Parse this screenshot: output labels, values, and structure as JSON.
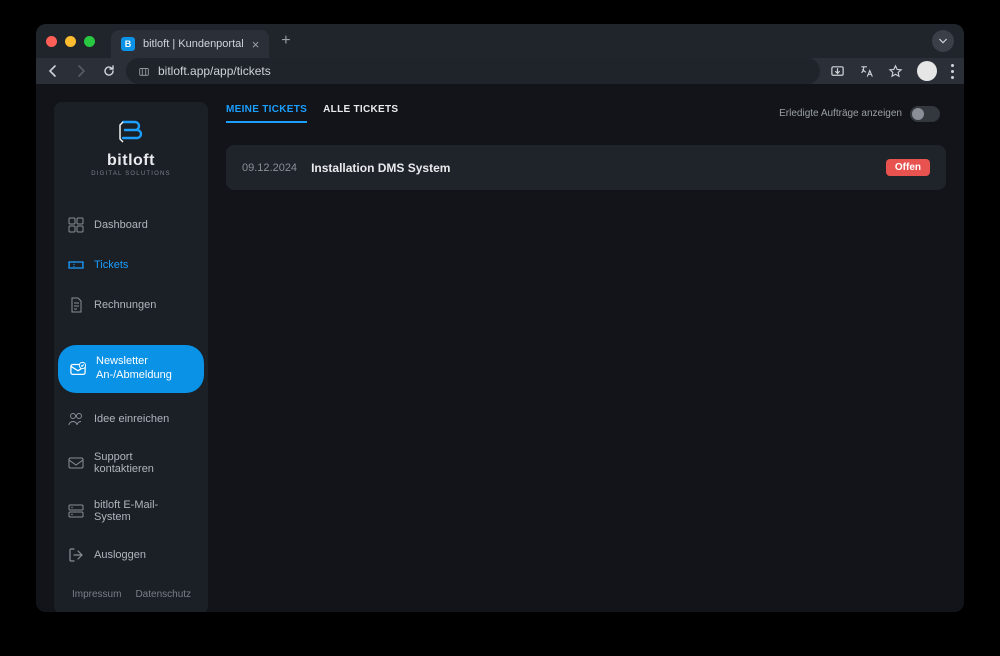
{
  "browser": {
    "tab_title": "bitloft | Kundenportal",
    "url": "bitloft.app/app/tickets"
  },
  "logo": {
    "name": "bitloft",
    "subtitle": "Digital Solutions"
  },
  "sidebar": {
    "items": [
      {
        "label": "Dashboard"
      },
      {
        "label": "Tickets"
      },
      {
        "label": "Rechnungen"
      },
      {
        "label": "Newsletter\nAn-/Abmeldung"
      },
      {
        "label": "Idee einreichen"
      },
      {
        "label": "Support kontaktieren"
      },
      {
        "label": "bitloft E-Mail-System"
      },
      {
        "label": "Ausloggen"
      }
    ],
    "footer": {
      "impressum": "Impressum",
      "datenschutz": "Datenschutz"
    }
  },
  "main": {
    "tabs": [
      {
        "label": "MEINE TICKETS"
      },
      {
        "label": "ALLE TICKETS"
      }
    ],
    "toggle_label": "Erledigte Aufträge anzeigen",
    "tickets": [
      {
        "date": "09.12.2024",
        "title": "Installation DMS System",
        "status": "Offen"
      }
    ]
  },
  "colors": {
    "accent": "#0a92e6",
    "status_open": "#e8524f"
  }
}
